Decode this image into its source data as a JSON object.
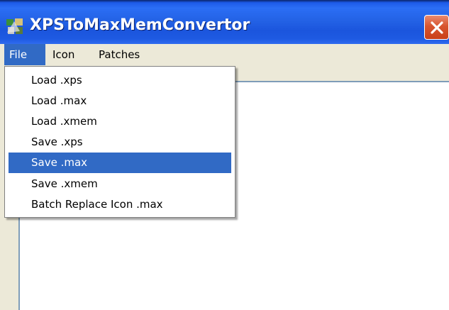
{
  "window": {
    "title": "XPSToMaxMemConvertor",
    "app_icon": "app-icon",
    "close_icon": "close-icon"
  },
  "menubar": {
    "items": [
      {
        "label": "File",
        "active": true
      },
      {
        "label": "Icon",
        "active": false
      },
      {
        "label": "Patches",
        "active": false
      }
    ]
  },
  "file_menu": {
    "items": [
      {
        "label": "Load .xps"
      },
      {
        "label": "Load .max"
      },
      {
        "label": "Load .xmem"
      },
      {
        "label": "Save .xps"
      },
      {
        "label": "Save .max",
        "highlighted": true
      },
      {
        "label": "Save .xmem"
      },
      {
        "label": "Batch Replace Icon .max"
      }
    ]
  },
  "colors": {
    "titlebar": "#2463e6",
    "highlight": "#316ac5",
    "window_bg": "#ece9d8",
    "close_button": "#d8552f"
  }
}
